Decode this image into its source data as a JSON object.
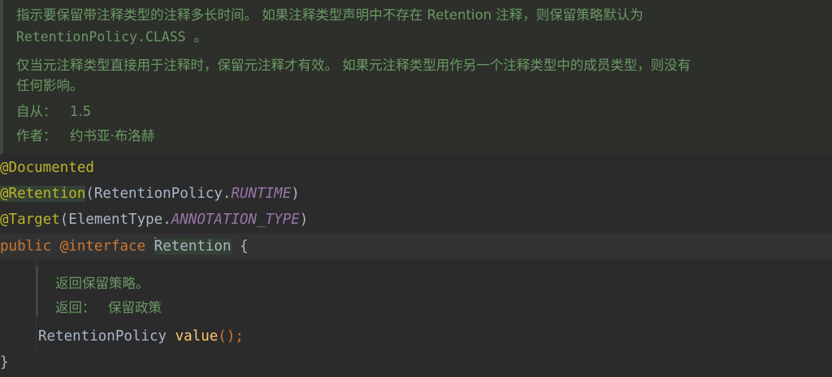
{
  "doc": {
    "line1": "指示要保留带注释类型的注释多长时间。 如果注释类型声明中不存在 Retention 注释，则保留策略默认为",
    "line2": "RetentionPolicy.CLASS 。",
    "line3": "仅当元注释类型直接用于注释时，保留元注释才有效。 如果元注释类型用作另一个注释类型中的成员类型，则没有",
    "line4": "任何影响。",
    "since_label": "自从：",
    "since_value": "1.5",
    "author_label": "作者：",
    "author_value": "约书亚·布洛赫"
  },
  "code": {
    "documented": "@Documented",
    "retention_annotation": "@Retention",
    "retention_open": "(RetentionPolicy.",
    "retention_const": "RUNTIME",
    "retention_close": ")",
    "target_annotation": "@Target",
    "target_open": "(ElementType.",
    "target_const": "ANNOTATION_TYPE",
    "target_close": ")",
    "kw_public": "public",
    "kw_interface": "@interface",
    "type_name": "Retention",
    "open_brace": "{",
    "method_return_type": "RetentionPolicy",
    "method_name": "value",
    "method_parens": "();",
    "close_brace": "}"
  },
  "inner_doc": {
    "line1": "返回保留策略。",
    "returns_label": "返回：",
    "returns_value": "保留政策"
  },
  "colors": {
    "background": "#2b2b2b",
    "doc_text": "#6a9a63",
    "annotation": "#bbb529",
    "keyword": "#cc7832",
    "constant": "#9876aa",
    "method": "#ffc66d",
    "default_text": "#a9b7c6"
  }
}
